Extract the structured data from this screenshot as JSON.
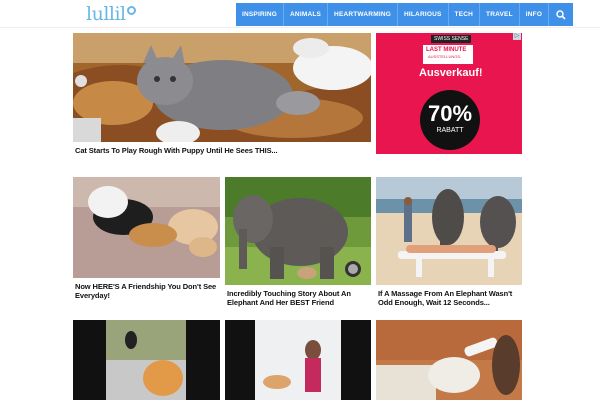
{
  "logo": {
    "text": "lullil"
  },
  "nav": {
    "items": [
      "INSPIRING",
      "ANIMALS",
      "HEARTWARMING",
      "HILARIOUS",
      "TECH",
      "TRAVEL",
      "INFO"
    ]
  },
  "articles": [
    {
      "title": "Cat Starts To Play Rough With Puppy Until He Sees THIS..."
    },
    {
      "title": "Now HERE'S A Friendship You Don't See Everyday!"
    },
    {
      "title": "Incredibly Touching Story About An Elephant And Her BEST Friend"
    },
    {
      "title": "If A Massage From An Elephant Wasn't Odd Enough, Wait 12 Seconds..."
    }
  ],
  "ad": {
    "brand": "SWISS SENSE",
    "line1": "LAST MINUTE",
    "line2": "AUSSTELLUNGS-",
    "headline": "Ausverkauf!",
    "percent": "70%",
    "label": "RABATT"
  },
  "colors": {
    "accent": "#3f90e8",
    "logo": "#6ab7e6",
    "ad": "#e8154f"
  },
  "icons": {
    "search": "search-icon",
    "ad_close": "ad-choices-icon"
  }
}
